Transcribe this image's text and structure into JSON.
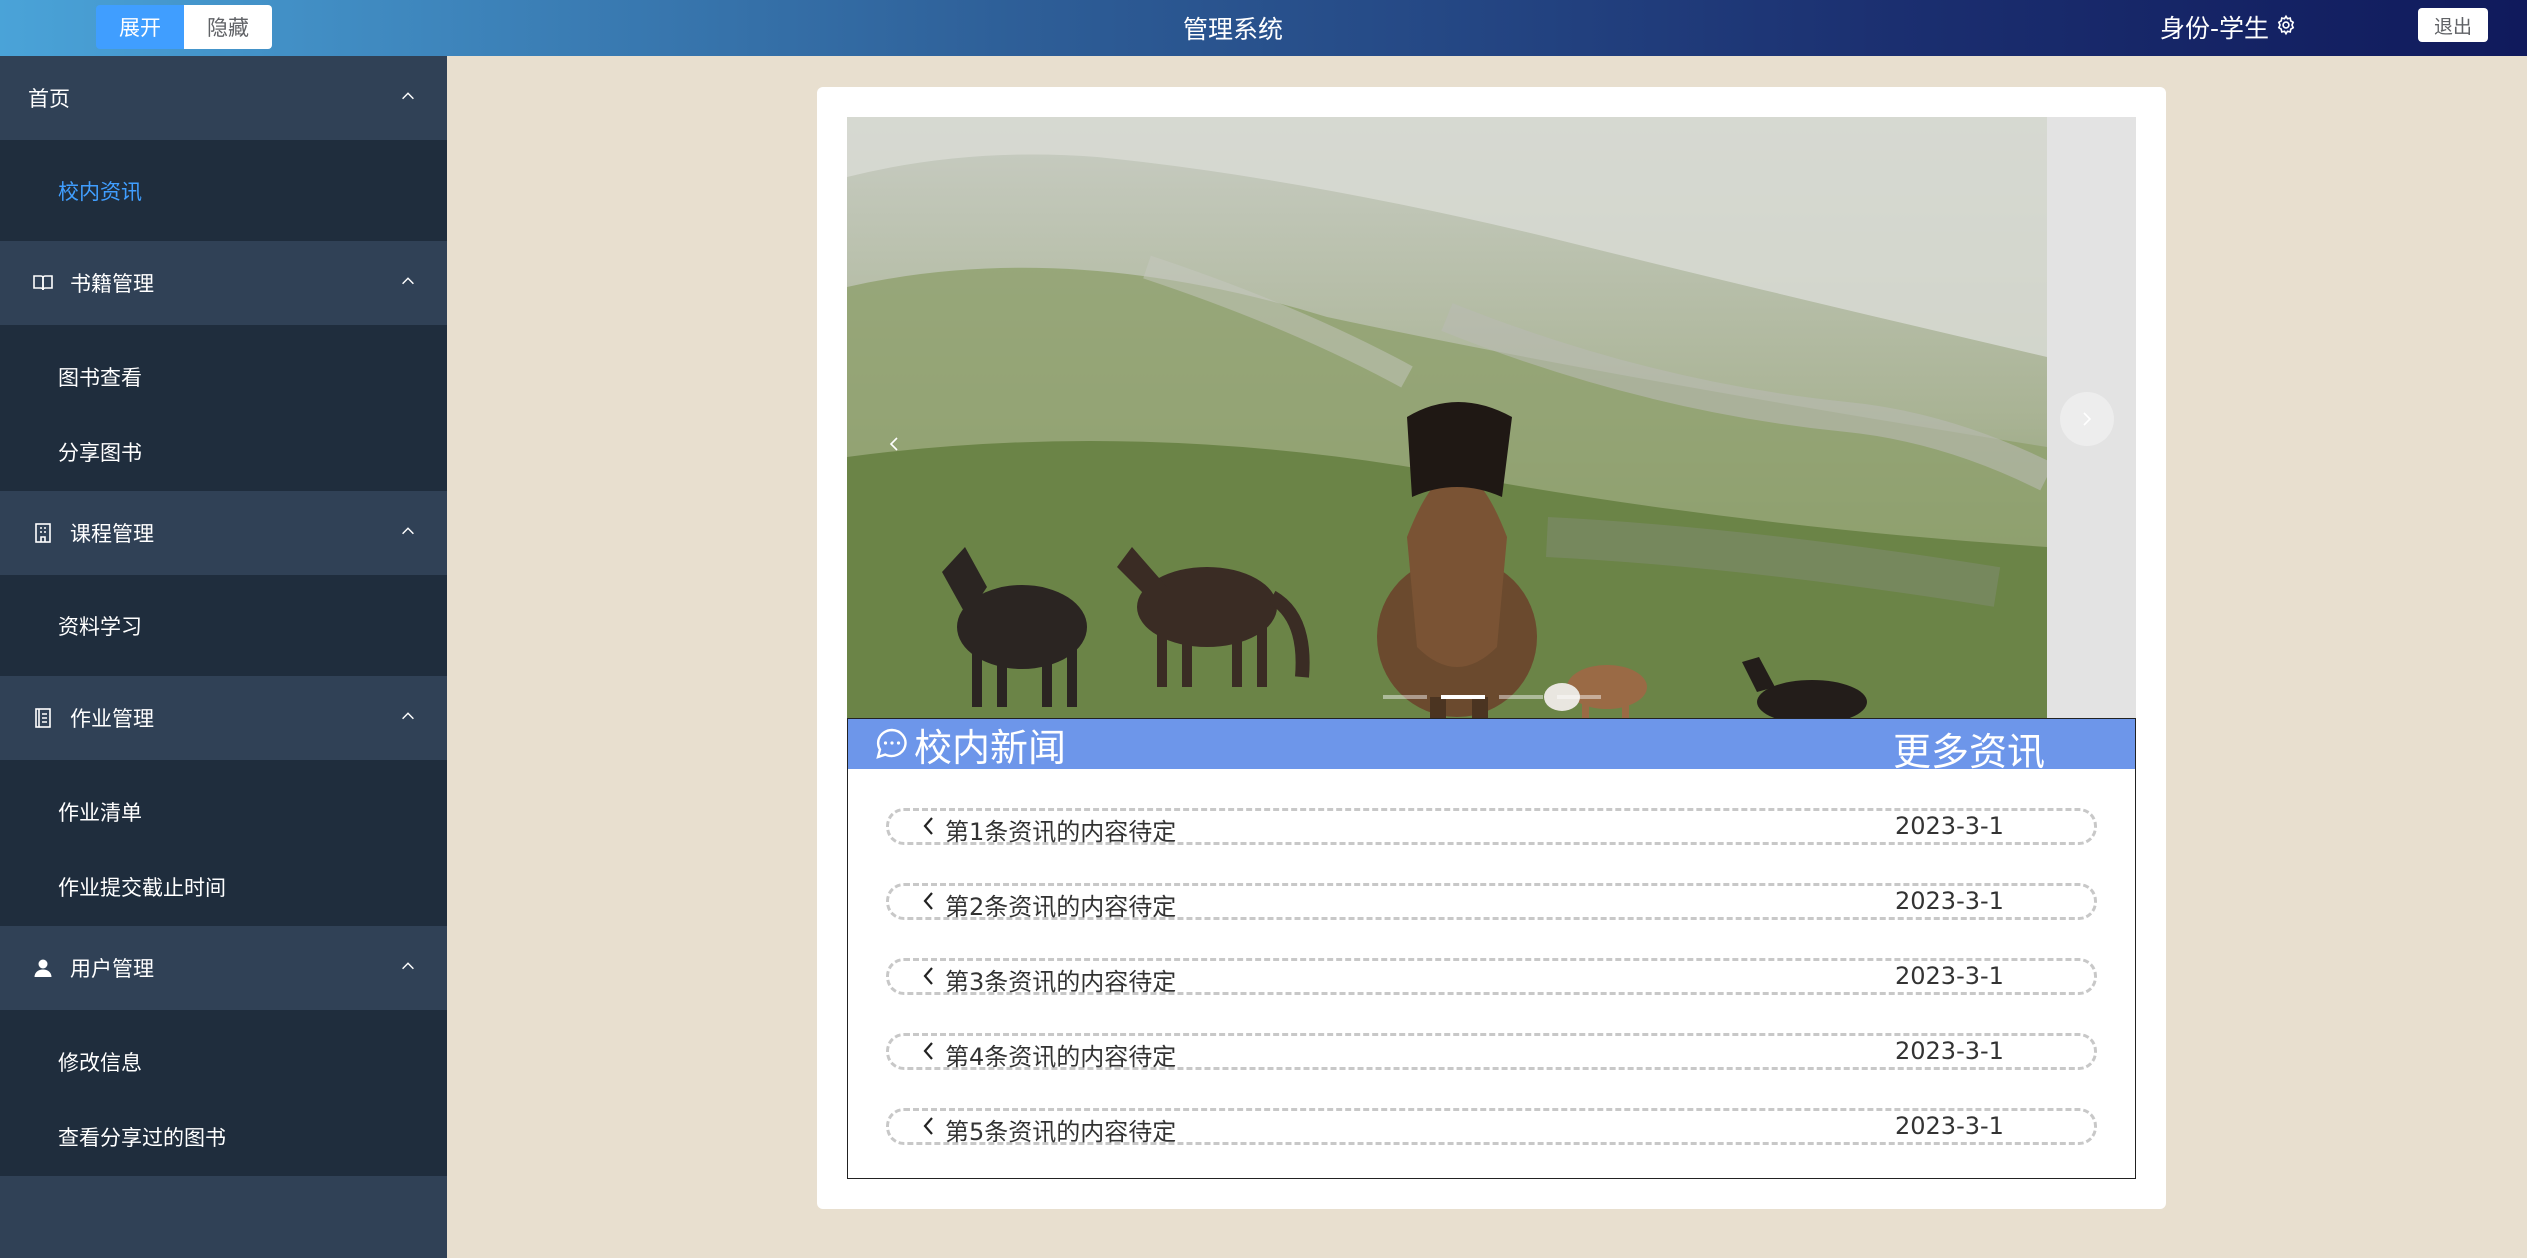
{
  "header": {
    "expand_label": "展开",
    "hide_label": "隐藏",
    "title": "管理系统",
    "identity": "身份-学生",
    "logout_label": "退出"
  },
  "sidebar": {
    "groups": [
      {
        "title": "首页",
        "icon": "none",
        "items": [
          "校内资讯"
        ]
      },
      {
        "title": "书籍管理",
        "icon": "book-icon",
        "items": [
          "图书查看",
          "分享图书"
        ]
      },
      {
        "title": "课程管理",
        "icon": "building-icon",
        "items": [
          "资料学习"
        ]
      },
      {
        "title": "作业管理",
        "icon": "list-icon",
        "items": [
          "作业清单",
          "作业提交截止时间"
        ]
      },
      {
        "title": "用户管理",
        "icon": "user-icon",
        "items": [
          "修改信息",
          "查看分享过的图书"
        ]
      }
    ],
    "active_item": "校内资讯"
  },
  "carousel": {
    "slide_count": 4,
    "active_index": 1,
    "image_subject": "horses on mountain pasture"
  },
  "news": {
    "title": "校内新闻",
    "more": "更多资讯",
    "items": [
      {
        "text": "第1条资讯的内容待定",
        "date": "2023-3-1"
      },
      {
        "text": "第2条资讯的内容待定",
        "date": "2023-3-1"
      },
      {
        "text": "第3条资讯的内容待定",
        "date": "2023-3-1"
      },
      {
        "text": "第4条资讯的内容待定",
        "date": "2023-3-1"
      },
      {
        "text": "第5条资讯的内容待定",
        "date": "2023-3-1"
      }
    ]
  },
  "colors": {
    "sidebar_bg": "#304156",
    "submenu_bg": "#1f2d3d",
    "active_text": "#409eff",
    "news_header": "#6d96ea",
    "page_bg": "#e8dfcf"
  }
}
